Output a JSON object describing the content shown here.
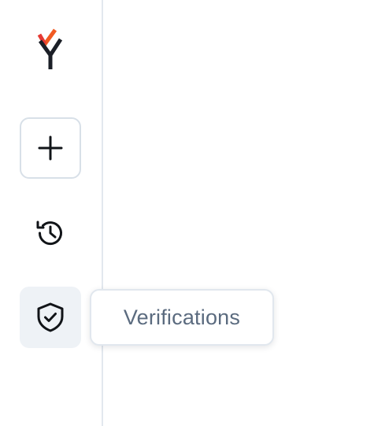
{
  "sidebar": {
    "logo_icon": "brand-logo-icon",
    "items": [
      {
        "id": "new",
        "icon": "plus-icon"
      },
      {
        "id": "history",
        "icon": "history-icon"
      },
      {
        "id": "verifications",
        "icon": "shield-check-icon"
      }
    ]
  },
  "tooltip": {
    "label": "Verifications"
  },
  "colors": {
    "logo_orange": "#f15a22",
    "logo_red": "#e53935",
    "logo_dark": "#1b1f27",
    "active_bg": "#eef2f6",
    "border": "#d8e0e8",
    "divider": "#e2e8ee",
    "tooltip_text": "#5b6b7f"
  }
}
